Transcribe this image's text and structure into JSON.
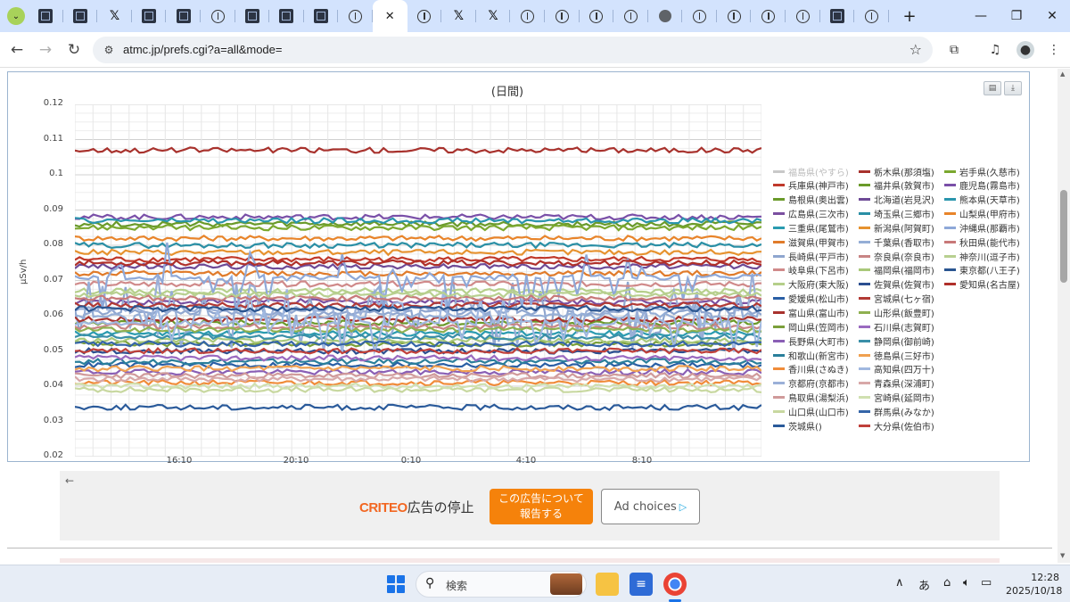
{
  "browser": {
    "tabs": [
      {
        "icon": "atmc"
      },
      {
        "icon": "atmc"
      },
      {
        "icon": "x"
      },
      {
        "icon": "atmc"
      },
      {
        "icon": "atmc"
      },
      {
        "icon": "circle"
      },
      {
        "icon": "atmc"
      },
      {
        "icon": "atmc"
      },
      {
        "icon": "atmc"
      },
      {
        "icon": "circle"
      },
      {
        "icon": "close",
        "active": true
      },
      {
        "icon": "circle"
      },
      {
        "icon": "x"
      },
      {
        "icon": "x"
      },
      {
        "icon": "circle"
      },
      {
        "icon": "circle"
      },
      {
        "icon": "circle"
      },
      {
        "icon": "circle"
      },
      {
        "icon": "globe"
      },
      {
        "icon": "circle"
      },
      {
        "icon": "circle"
      },
      {
        "icon": "circle"
      },
      {
        "icon": "circle"
      },
      {
        "icon": "atmc"
      },
      {
        "icon": "circle"
      }
    ],
    "url": "atmc.jp/prefs.cgi?a=all&mode="
  },
  "chart_data": {
    "type": "line",
    "title": "(日間)",
    "ylabel": "μSv/h",
    "ylim": [
      0.02,
      0.12
    ],
    "yticks": [
      "0.12",
      "0.11",
      "0.1",
      "0.09",
      "0.08",
      "0.07",
      "0.06",
      "0.05",
      "0.04",
      "0.03",
      "0.02"
    ],
    "xticks": [
      "16:10",
      "20:10",
      "0:10",
      "4:10",
      "8:10"
    ],
    "grid": true,
    "legend_position": "right",
    "series": [
      {
        "name": "福島県(やすら)",
        "color": "#c8c8c8",
        "level": null,
        "hidden": true
      },
      {
        "name": "兵庫県(神戸市)",
        "color": "#c0392b",
        "level": 0.076
      },
      {
        "name": "島根県(奥出雲)",
        "color": "#6a9a2a",
        "level": 0.058
      },
      {
        "name": "広島県(三次市)",
        "color": "#7b4fa0",
        "level": 0.064
      },
      {
        "name": "三重県(尾鷲市)",
        "color": "#2a9bb0",
        "level": 0.055
      },
      {
        "name": "滋賀県(甲賀市)",
        "color": "#e07b2a",
        "level": 0.072
      },
      {
        "name": "長崎県(平戸市)",
        "color": "#8fa6cf",
        "level": 0.061
      },
      {
        "name": "岐阜県(下呂市)",
        "color": "#d08a8a",
        "level": 0.069
      },
      {
        "name": "大阪府(東大阪)",
        "color": "#b5cf8a",
        "level": 0.067
      },
      {
        "name": "愛媛県(松山市)",
        "color": "#2a5fa5",
        "level": 0.046
      },
      {
        "name": "富山県(富山市)",
        "color": "#a8322d",
        "level": 0.059
      },
      {
        "name": "岡山県(笠岡市)",
        "color": "#7ba03a",
        "level": 0.052
      },
      {
        "name": "長野県(大町市)",
        "color": "#8a5fb5",
        "level": 0.044
      },
      {
        "name": "和歌山(新宮市)",
        "color": "#2a7f9b",
        "level": 0.047
      },
      {
        "name": "香川県(さぬき)",
        "color": "#f08c3a",
        "level": 0.041
      },
      {
        "name": "京都府(京都市)",
        "color": "#9bb0d8",
        "level": 0.062
      },
      {
        "name": "鳥取県(湯梨浜)",
        "color": "#d09a9a",
        "level": 0.043
      },
      {
        "name": "山口県(山口市)",
        "color": "#c8d8a0",
        "level": 0.039
      },
      {
        "name": "茨城県()",
        "color": "#2a5a9a",
        "level": 0.034
      },
      {
        "name": "栃木県(那須塩)",
        "color": "#a8322d",
        "level": 0.107
      },
      {
        "name": "福井県(敦賀市)",
        "color": "#6a9a2a",
        "level": 0.086
      },
      {
        "name": "北海道(岩見沢)",
        "color": "#6e4a96",
        "level": 0.074
      },
      {
        "name": "埼玉県(三郷市)",
        "color": "#2a8fa5",
        "level": 0.08
      },
      {
        "name": "新潟県(阿賀町)",
        "color": "#e6922f",
        "level": 0.078
      },
      {
        "name": "千葉県(香取市)",
        "color": "#95aed6",
        "level": 0.06
      },
      {
        "name": "奈良県(奈良市)",
        "color": "#c88484",
        "level": 0.057
      },
      {
        "name": "福岡県(福岡市)",
        "color": "#a9c87a",
        "level": 0.053
      },
      {
        "name": "佐賀県(佐賀市)",
        "color": "#2b4f90",
        "level": 0.05
      },
      {
        "name": "宮城県(七ヶ宿)",
        "color": "#b23a35",
        "level": 0.063
      },
      {
        "name": "山形県(飯豊町)",
        "color": "#8fb050",
        "level": 0.056
      },
      {
        "name": "石川県(志賀町)",
        "color": "#9a6ac0",
        "level": 0.048
      },
      {
        "name": "静岡県(御前崎)",
        "color": "#3a8fa8",
        "level": 0.054
      },
      {
        "name": "徳島県(三好市)",
        "color": "#f0a050",
        "level": 0.045
      },
      {
        "name": "高知県(四万十)",
        "color": "#a0b8e0",
        "level": 0.058
      },
      {
        "name": "青森県(深浦町)",
        "color": "#d8a8a8",
        "level": 0.042
      },
      {
        "name": "宮崎県(延岡市)",
        "color": "#d0e0b0",
        "level": 0.04
      },
      {
        "name": "群馬県(みなか)",
        "color": "#3565a8",
        "level": 0.052
      },
      {
        "name": "大分県(佐伯市)",
        "color": "#c0403a",
        "level": 0.05
      },
      {
        "name": "岩手県(久慈市)",
        "color": "#7ba82f",
        "level": 0.085
      },
      {
        "name": "鹿児島(霧島市)",
        "color": "#7a50a8",
        "level": 0.088
      },
      {
        "name": "熊本県(天草市)",
        "color": "#2a95ad",
        "level": 0.087
      },
      {
        "name": "山梨県(甲府市)",
        "color": "#e8842a",
        "level": 0.082
      },
      {
        "name": "沖縄県(那覇市)",
        "color": "#8ea8d8",
        "level": 0.071
      },
      {
        "name": "秋田県(能代市)",
        "color": "#c87878",
        "level": 0.065
      },
      {
        "name": "神奈川(逗子市)",
        "color": "#b8d090",
        "level": 0.066
      },
      {
        "name": "東京都(八王子)",
        "color": "#2a5590",
        "level": 0.062
      },
      {
        "name": "愛知県(名古屋)",
        "color": "#b0302a",
        "level": 0.075
      }
    ]
  },
  "ad": {
    "brand": "CRITEO",
    "stop_label": "広告の停止",
    "report_label_1": "この広告について",
    "report_label_2": "報告する",
    "choices_label": "Ad choices"
  },
  "taskbar": {
    "search_placeholder": "検索",
    "ime": "あ",
    "time": "12:28",
    "date": "2025/10/18"
  },
  "colors": {
    "tabstrip": "#d3e3fd",
    "accent": "#1a73e8",
    "report_button": "#f5820b"
  }
}
